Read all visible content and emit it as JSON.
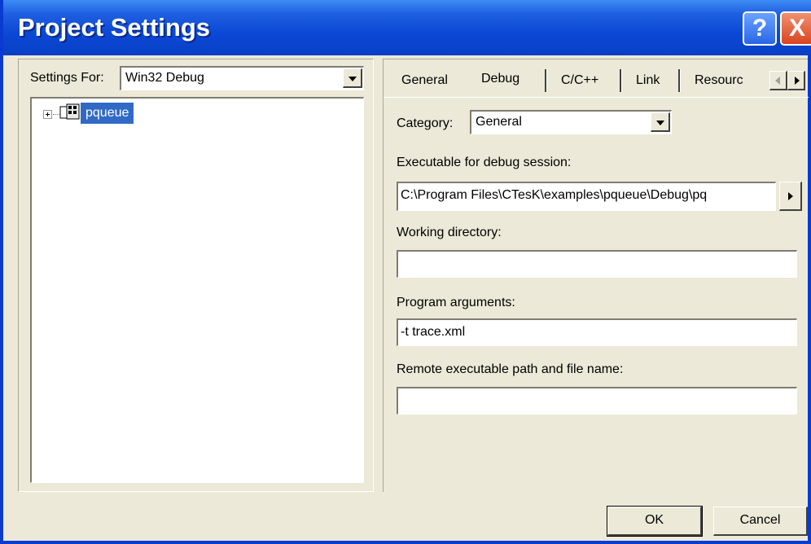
{
  "window": {
    "title": "Project Settings"
  },
  "title_buttons": {
    "help": "?",
    "close": "X"
  },
  "left": {
    "settings_for_label": "Settings For:",
    "settings_for_value": "Win32 Debug",
    "tree_items": [
      {
        "label": "pqueue",
        "selected": true
      }
    ]
  },
  "tabs": [
    {
      "label": "General",
      "active": false
    },
    {
      "label": "Debug",
      "active": true
    },
    {
      "label": "C/C++",
      "active": false
    },
    {
      "label": "Link",
      "active": false
    },
    {
      "label": "Resourc",
      "active": false
    }
  ],
  "debug": {
    "category_label": "Category:",
    "category_value": "General",
    "exe_label": "Executable for debug session:",
    "exe_value": "C:\\Program Files\\CTesK\\examples\\pqueue\\Debug\\pq",
    "workdir_label": "Working directory:",
    "workdir_value": "",
    "args_label": "Program arguments:",
    "args_value": "-t trace.xml",
    "remote_label": "Remote executable path and file name:",
    "remote_value": ""
  },
  "buttons": {
    "ok": "OK",
    "cancel": "Cancel"
  },
  "colors": {
    "titlebar": "#0b48d6",
    "selection": "#316ac5",
    "face": "#ece9d8"
  },
  "icons": [
    "help-icon",
    "close-icon",
    "expand-icon",
    "project-icon",
    "dropdown-arrow-icon",
    "scroll-left-icon",
    "scroll-right-icon",
    "browse-arrow-icon"
  ]
}
